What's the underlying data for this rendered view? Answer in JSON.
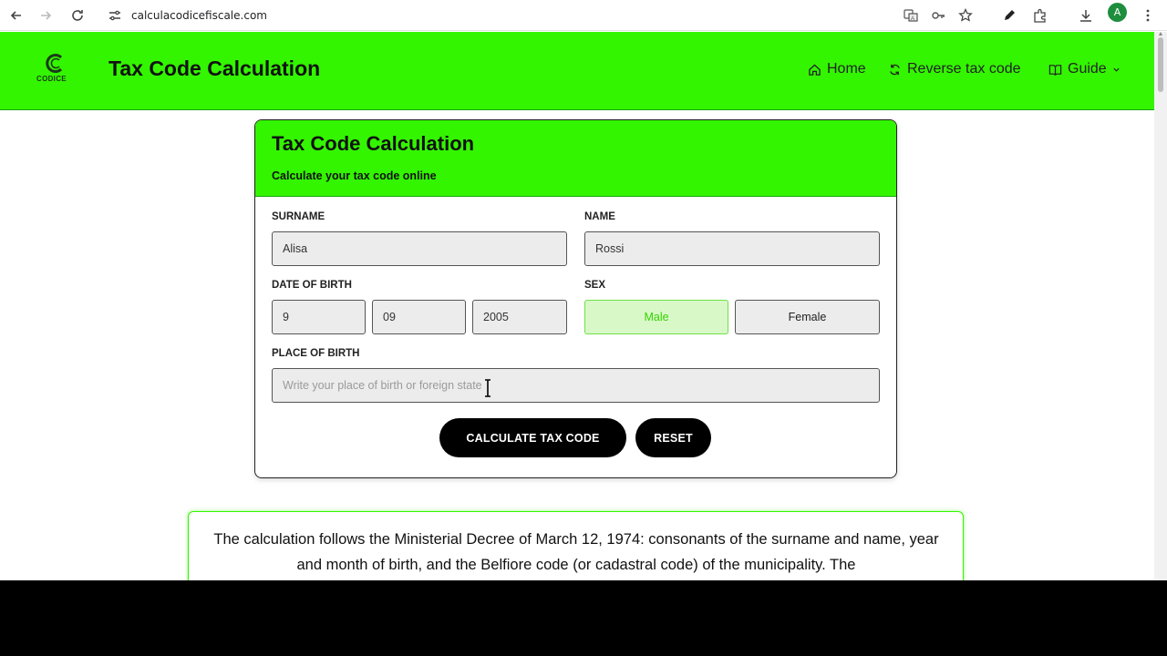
{
  "browser": {
    "url": "calculacodicefiscale.com",
    "profile_initial": "A",
    "icons": [
      "back-icon",
      "forward-icon",
      "reload-icon",
      "site-info-icon",
      "translate-icon",
      "password-key-icon",
      "bookmark-star-icon",
      "pen-icon",
      "extensions-icon",
      "download-icon",
      "menu-dots-icon"
    ]
  },
  "header": {
    "logo_word": "CODICE",
    "title": "Tax Code Calculation",
    "nav": {
      "home": "Home",
      "reverse": "Reverse tax code",
      "guide": "Guide"
    },
    "accent_color": "#33f500"
  },
  "form": {
    "title": "Tax Code Calculation",
    "subtitle": "Calculate your tax code online",
    "surname_label": "SURNAME",
    "surname_value": "Alisa",
    "name_label": "NAME",
    "name_value": "Rossi",
    "dob_label": "DATE OF BIRTH",
    "dob_day": "9",
    "dob_month": "09",
    "dob_year": "2005",
    "sex_label": "SEX",
    "sex_male": "Male",
    "sex_female": "Female",
    "sex_selected": "Male",
    "place_label": "PLACE OF BIRTH",
    "place_placeholder": "Write your place of birth or foreign state",
    "calculate_button": "CALCULATE TAX CODE",
    "reset_button": "RESET"
  },
  "info": {
    "text": "The calculation follows the Ministerial Decree of March 12, 1974: consonants of the surname and name, year and month of birth, and the Belfiore code (or cadastral code) of the municipality. The"
  }
}
